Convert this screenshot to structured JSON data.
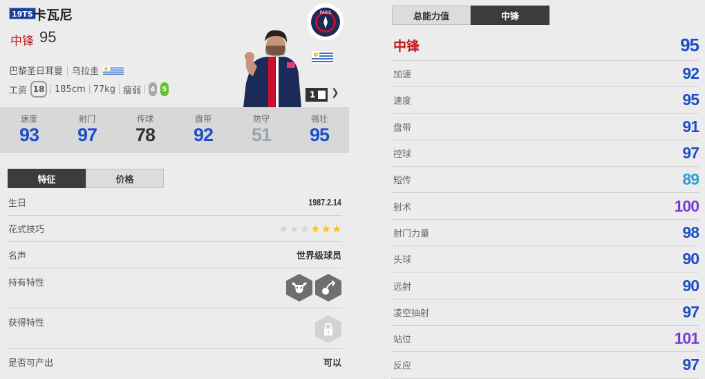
{
  "player": {
    "season_badge": "19TS",
    "name": "卡瓦尼",
    "position": "中锋",
    "overall": "95",
    "club": "巴黎圣日耳曼",
    "nation": "乌拉圭",
    "wage_label": "工资",
    "wage": "18",
    "height": "185cm",
    "weight": "77kg",
    "body_type": "瘦弱",
    "weak_foot": "4",
    "strong_foot": "5",
    "level": "1",
    "club_logo_text": "PARIS"
  },
  "summary": [
    {
      "label": "速度",
      "value": "93",
      "color": "#1e4fc9"
    },
    {
      "label": "射门",
      "value": "97",
      "color": "#1e4fc9"
    },
    {
      "label": "传球",
      "value": "78",
      "color": "#333333"
    },
    {
      "label": "盘带",
      "value": "92",
      "color": "#1e4fc9"
    },
    {
      "label": "防守",
      "value": "51",
      "color": "#9aa3ad"
    },
    {
      "label": "强壮",
      "value": "95",
      "color": "#1e4fc9"
    }
  ],
  "left_tabs": [
    "特征",
    "价格"
  ],
  "info": {
    "birthday_label": "生日",
    "birthday": "1987.2.14",
    "skill_label": "花式技巧",
    "skill_stars": 3,
    "skill_stars_max": 6,
    "reputation_label": "名声",
    "reputation": "世界级球员",
    "traits_label": "持有特性",
    "trait_icons": [
      "bull-icon",
      "volley-icon"
    ],
    "acquired_label": "获得特性",
    "acquired_icon": "lock-icon",
    "producible_label": "是否可产出",
    "producible": "可以"
  },
  "right_tabs": [
    "总能力值",
    "中锋"
  ],
  "attributes": {
    "header": {
      "label": "中锋",
      "value": "95",
      "color": "#1e4fc9"
    },
    "items": [
      {
        "label": "加速",
        "value": "92",
        "color": "#1e4fc9"
      },
      {
        "label": "速度",
        "value": "95",
        "color": "#1e4fc9"
      },
      {
        "label": "盘带",
        "value": "91",
        "color": "#1e4fc9"
      },
      {
        "label": "控球",
        "value": "97",
        "color": "#1e4fc9"
      },
      {
        "label": "短传",
        "value": "89",
        "color": "#2b9fd6"
      },
      {
        "label": "射术",
        "value": "100",
        "color": "#7a3fd1"
      },
      {
        "label": "射门力量",
        "value": "98",
        "color": "#1e4fc9"
      },
      {
        "label": "头球",
        "value": "90",
        "color": "#1e4fc9"
      },
      {
        "label": "远射",
        "value": "90",
        "color": "#1e4fc9"
      },
      {
        "label": "凌空抽射",
        "value": "97",
        "color": "#1e4fc9"
      },
      {
        "label": "站位",
        "value": "101",
        "color": "#7a3fd1"
      },
      {
        "label": "反应",
        "value": "97",
        "color": "#1e4fc9"
      }
    ]
  }
}
